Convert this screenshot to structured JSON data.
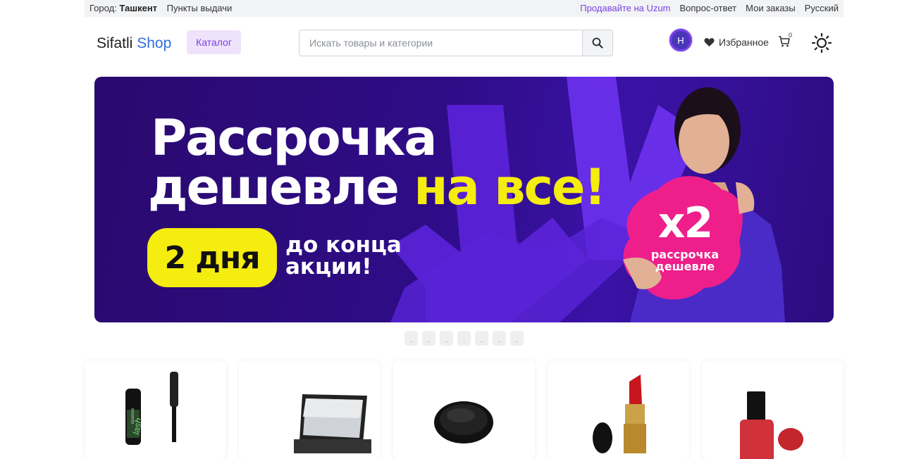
{
  "topbar": {
    "city_label": "Город:",
    "city": "Ташкент",
    "pickup": "Пункты выдачи",
    "sell": "Продавайте на Uzum",
    "faq": "Вопрос-ответ",
    "orders": "Мои заказы",
    "language": "Русский"
  },
  "header": {
    "logo_a": "Sifatli",
    "logo_b": "Shop",
    "catalog": "Каталог",
    "search_placeholder": "Искать товары и категории",
    "avatar_letter": "H",
    "favorites": "Избранное",
    "cart_count": "0"
  },
  "banner": {
    "line1": "Рассрочка",
    "line2a": "дешевле",
    "line2b": "на все!",
    "pill": "2 дня",
    "sub1": "до конца",
    "sub2": "акции!",
    "badge_big": "x2",
    "badge_sub1": "рассрочка",
    "badge_sub2": "дешевле"
  },
  "carousel": {
    "dots": [
      ".",
      ".",
      ".",
      ".",
      ".",
      ".",
      "."
    ]
  },
  "products": [
    {
      "icon": "mascara",
      "label": "essence",
      "label2": "lash"
    },
    {
      "icon": "eyeshadow-palette"
    },
    {
      "icon": "compact-powder"
    },
    {
      "icon": "lipstick"
    },
    {
      "icon": "nail-polish"
    }
  ],
  "colors": {
    "accent": "#7b3fe4",
    "banner_yellow": "#f5ec10",
    "badge_pink": "#ee1f8b",
    "logo_blue": "#2f6fe0"
  }
}
